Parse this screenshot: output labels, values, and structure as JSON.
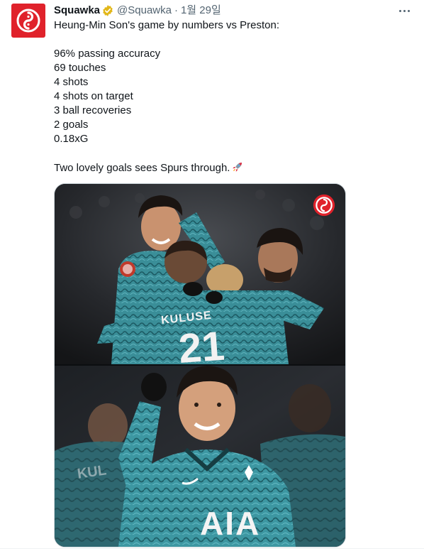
{
  "tweet": {
    "author": {
      "display_name": "Squawka",
      "handle": "@Squawka",
      "verified_icon": "gold-verified-badge-icon",
      "avatar_icon": "squawka-logo-icon",
      "brand_color": "#e0222b"
    },
    "separator": "·",
    "date": "1월 29일",
    "more_icon": "more-options-icon",
    "lines": [
      "Heung-Min Son's game by numbers vs Preston:",
      "",
      "96% passing accuracy",
      "69 touches",
      "4 shots",
      "4 shots on target",
      "3 ball recoveries",
      "2 goals",
      "0.18xG",
      "",
      "Two lovely goals sees Spurs through."
    ],
    "trailing_emoji_icon": "rocket-emoji-icon",
    "media": {
      "watermark_icon": "squawka-logo-icon",
      "top_photo_icon": "players-celebrating-photo",
      "bottom_photo_icon": "son-celebrating-photo",
      "shirt_name_text": "KULUSE",
      "shirt_number_text": "21",
      "sponsor_text": "AIA"
    }
  }
}
